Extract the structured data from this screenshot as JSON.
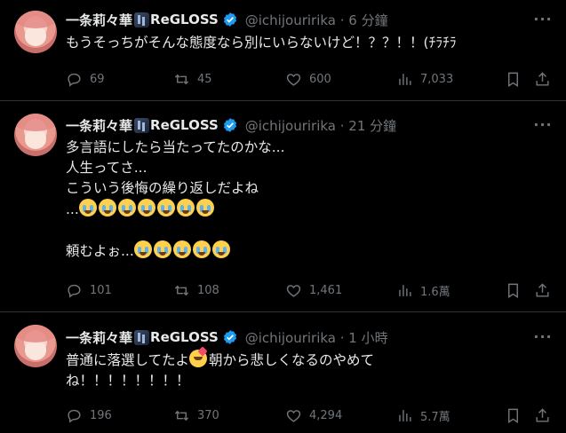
{
  "tweets": [
    {
      "author_name": "一条莉々華",
      "author_brand": "ReGLOSS",
      "handle_time": "@ichijouririka · 6 分鐘",
      "lines": [
        "もうそっちがそんな態度なら別にいらないけど！？？！！(ﾁﾗﾁﾗ"
      ],
      "stats": {
        "replies": "69",
        "reposts": "45",
        "likes": "600",
        "views": "7,033"
      }
    },
    {
      "author_name": "一条莉々華",
      "author_brand": "ReGLOSS",
      "handle_time": "@ichijouririka · 21 分鐘",
      "lines": [
        "多言語にしたら当たってたのかな...",
        "人生ってさ...",
        "こういう後悔の繰り返しだよね",
        "...",
        "",
        "頼むよぉ..."
      ],
      "stats": {
        "replies": "101",
        "reposts": "108",
        "likes": "1,461",
        "views": "1.6萬"
      }
    },
    {
      "author_name": "一条莉々華",
      "author_brand": "ReGLOSS",
      "handle_time": "@ichijouririka · 1 小時",
      "lines": [
        "普通に落選してたよ",
        "朝から悲しくなるのやめて",
        "ね！！！！！！！！"
      ],
      "stats": {
        "replies": "196",
        "reposts": "370",
        "likes": "4,294",
        "views": "5.7萬"
      }
    }
  ],
  "icons": [
    "more-icon",
    "reply-icon",
    "repost-icon",
    "like-icon",
    "views-icon",
    "bookmark-icon",
    "share-icon",
    "verified-icon",
    "crying-face-emoji",
    "smiling-face-with-hearts-emoji"
  ],
  "colors": {
    "background": "#000000",
    "text": "#e7e9ea",
    "secondary": "#71767b",
    "verified": "#1d9bf0",
    "divider": "#2f3336"
  }
}
